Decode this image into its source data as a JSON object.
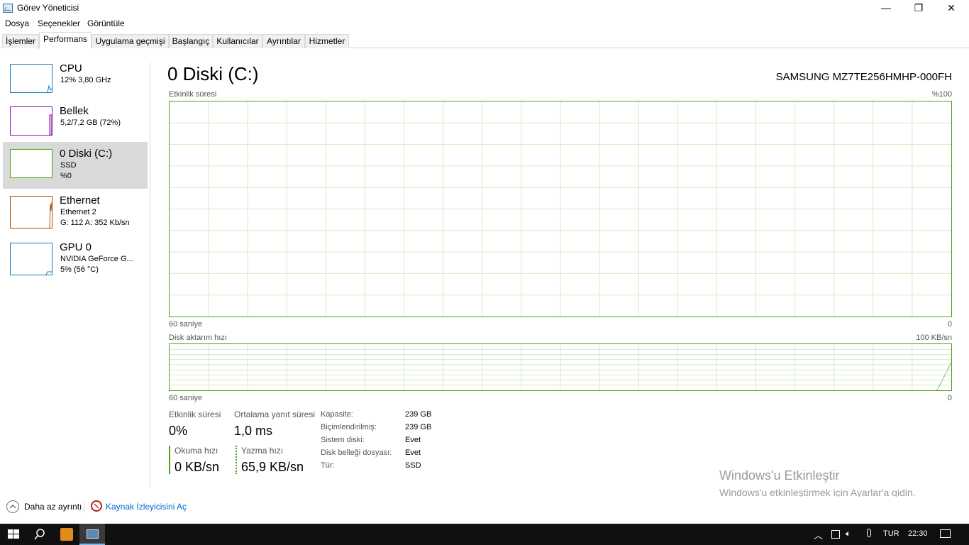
{
  "window": {
    "title": "Görev Yöneticisi",
    "minimize": "—",
    "maximize": "❐",
    "close": "✕"
  },
  "menu": [
    "Dosya",
    "Seçenekler",
    "Görüntüle"
  ],
  "tabs": [
    "İşlemler",
    "Performans",
    "Uygulama geçmişi",
    "Başlangıç",
    "Kullanıcılar",
    "Ayrıntılar",
    "Hizmetler"
  ],
  "active_tab": "Performans",
  "sidebar": {
    "items": [
      {
        "name": "CPU",
        "line1": "12% 3,80 GHz",
        "line2": "",
        "color": "#117dbb"
      },
      {
        "name": "Bellek",
        "line1": "5,2/7,2 GB (72%)",
        "line2": "",
        "color": "#8b12ae"
      },
      {
        "name": "0 Diski (C:)",
        "line1": "SSD",
        "line2": "%0",
        "color": "#4da60c"
      },
      {
        "name": "Ethernet",
        "line1": "Ethernet 2",
        "line2": "G: 112 A: 352 Kb/sn",
        "color": "#a74f01"
      },
      {
        "name": "GPU 0",
        "line1": "NVIDIA GeForce G...",
        "line2": "5% (56 °C)",
        "color": "#117dbb"
      }
    ],
    "selected_index": 2
  },
  "main": {
    "title": "0 Diski (C:)",
    "model": "SAMSUNG MZ7TE256HMHP-000FH",
    "graph1": {
      "label": "Etkinlik süresi",
      "max": "%100",
      "time_left": "60 saniye",
      "time_right": "0"
    },
    "graph2": {
      "label": "Disk aktarım hızı",
      "max": "100 KB/sn",
      "time_left": "60 saniye",
      "time_right": "0",
      "last_value_fraction": 0.6
    },
    "stats": {
      "activity_label": "Etkinlik süresi",
      "activity_value": "0%",
      "response_label": "Ortalama yanıt süresi",
      "response_value": "1,0 ms",
      "read_label": "Okuma hızı",
      "read_value": "0 KB/sn",
      "write_label": "Yazma hızı",
      "write_value": "65,9 KB/sn"
    },
    "properties": [
      {
        "label": "Kapasite:",
        "value": "239 GB"
      },
      {
        "label": "Biçimlendirilmiş:",
        "value": "239 GB"
      },
      {
        "label": "Sistem diski:",
        "value": "Evet"
      },
      {
        "label": "Disk belleği dosyası:",
        "value": "Evet"
      },
      {
        "label": "Tür:",
        "value": "SSD"
      }
    ]
  },
  "watermark": {
    "title": "Windows'u Etkinleştir",
    "subtitle": "Windows'u etkinleştirmek için Ayarlar'a gidin."
  },
  "footer": {
    "fewer_details": "Daha az ayrıntı",
    "resource_monitor": "Kaynak İzleyicisini Aç"
  },
  "taskbar": {
    "language": "TUR",
    "time": "22:30"
  },
  "colors": {
    "disk_green": "#4ca116",
    "grid_green": "#d7ebc6",
    "link_blue": "#0066cc"
  }
}
